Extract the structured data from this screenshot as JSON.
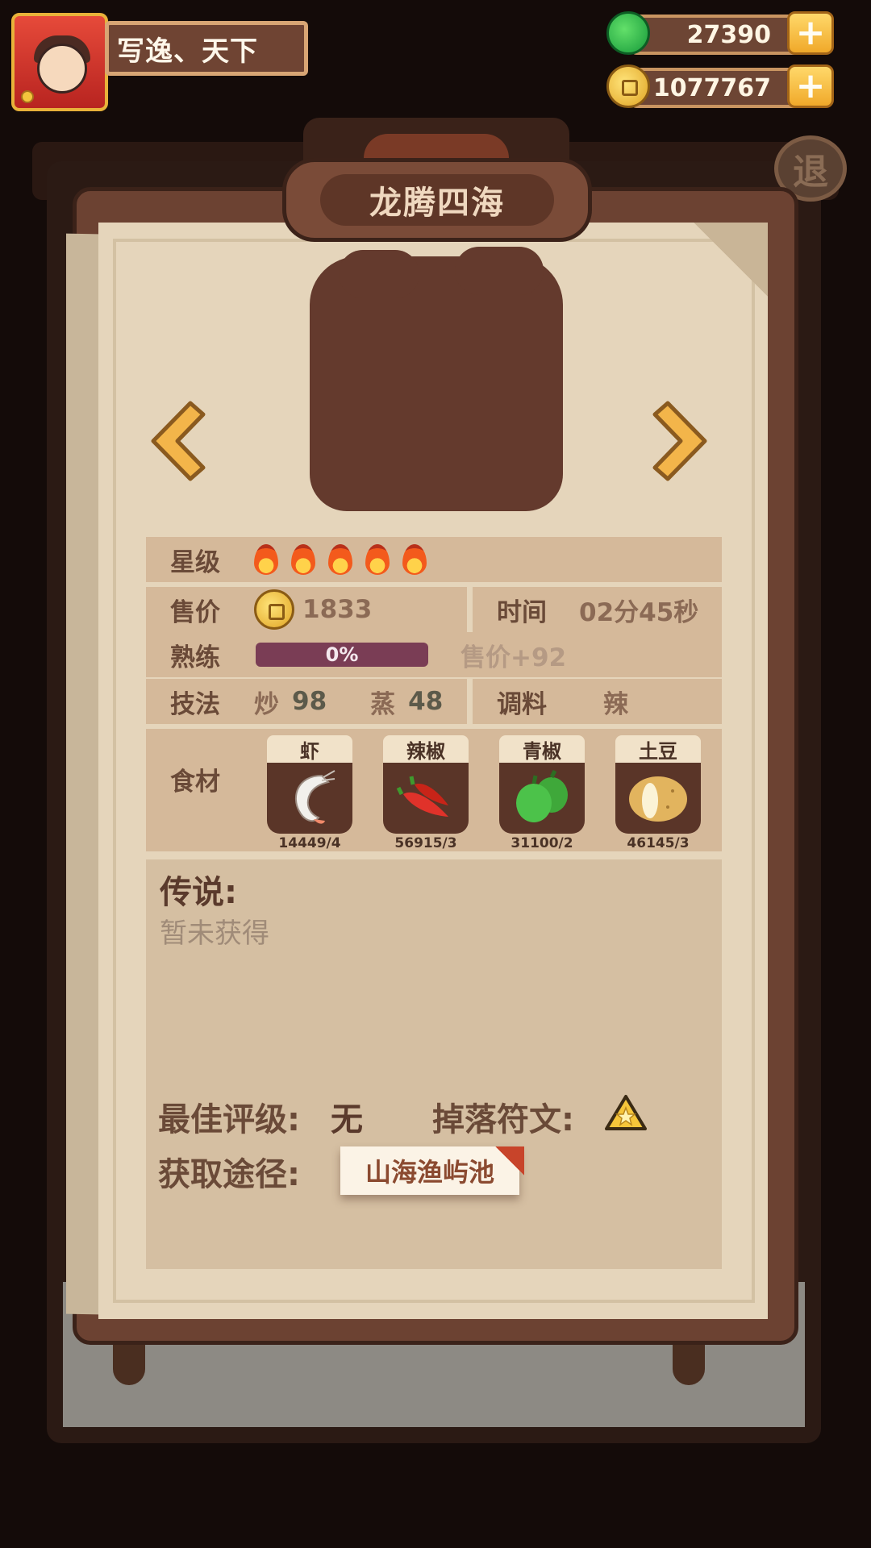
{
  "player": {
    "name": "写逸、天下"
  },
  "currency": {
    "jade": "27390",
    "coins": "1077767"
  },
  "exit_label": "退",
  "dish": {
    "title": "龙腾四海"
  },
  "info": {
    "stars_label": "星级",
    "star_count": 5,
    "price_label": "售价",
    "price_value": "1833",
    "time_label": "时间",
    "time_value": "02分45秒",
    "skill_label": "熟练",
    "skill_progress": "0%",
    "skill_bonus": "售价+92",
    "tech_label": "技法",
    "techniques": [
      {
        "name": "炒",
        "value": "98"
      },
      {
        "name": "蒸",
        "value": "48"
      }
    ],
    "season_label": "调料",
    "season_value": "辣"
  },
  "ingredients": {
    "label": "食材",
    "items": [
      {
        "name": "虾",
        "count": "14449/4",
        "icon": "shrimp-icon"
      },
      {
        "name": "辣椒",
        "count": "56915/3",
        "icon": "chili-icon"
      },
      {
        "name": "青椒",
        "count": "31100/2",
        "icon": "green-pepper-icon"
      },
      {
        "name": "土豆",
        "count": "46145/3",
        "icon": "potato-icon"
      }
    ]
  },
  "legend": {
    "title": "传说:",
    "text": "暂未获得"
  },
  "best_grade": {
    "label": "最佳评级:",
    "value": "无"
  },
  "drop_rune": {
    "label": "掉落符文:",
    "icon": "star-rune-icon"
  },
  "source": {
    "label": "获取途径:",
    "value": "山海渔屿池"
  },
  "colors": {
    "scroll_wood": "#6c4232",
    "paper": "#e5d5bb",
    "row_bg": "#d5b99a",
    "progress": "#7a3d55",
    "gold": "#f0a92a"
  }
}
